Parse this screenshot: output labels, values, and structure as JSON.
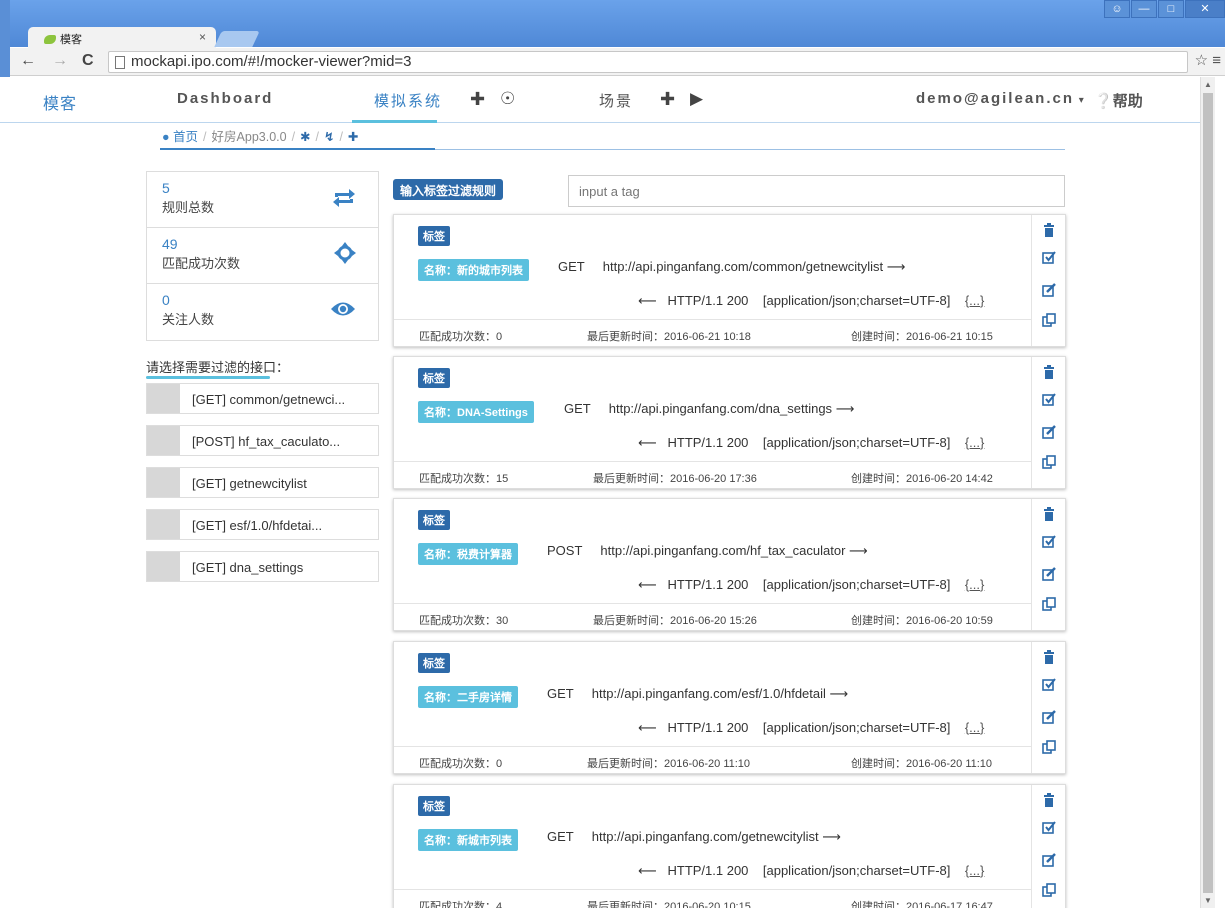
{
  "browser": {
    "tab_title": "模客",
    "tab_close": "×",
    "url": "mockapi.ipo.com/#!/mocker-viewer?mid=3",
    "back": "←",
    "forward": "→",
    "reload": "C",
    "toolbar_right": "☆ ≡"
  },
  "nav": {
    "brand": "模客",
    "dashboard": "Dashboard",
    "mock_system": "模拟系统",
    "scenes": "场景",
    "user": "demo@agilean.cn",
    "help": "帮助"
  },
  "breadcrumb": {
    "home": "首页",
    "project": "好房App3.0.0"
  },
  "stats": [
    {
      "value": "5",
      "label": "规则总数",
      "icon": "refresh-icon"
    },
    {
      "value": "49",
      "label": "匹配成功次数",
      "icon": "crosshair-icon"
    },
    {
      "value": "0",
      "label": "关注人数",
      "icon": "eye-icon"
    }
  ],
  "filter": {
    "title": "请选择需要过滤的接口：",
    "items": [
      "[GET] common/getnewci...",
      "[POST] hf_tax_caculato...",
      "[GET] getnewcitylist",
      "[GET] esf/1.0/hfdetai...",
      "[GET] dna_settings"
    ]
  },
  "tag_filter": {
    "label": "输入标签过滤规则",
    "placeholder": "input a tag"
  },
  "cards": [
    {
      "tag": "标签",
      "name": "名称：新的城市列表",
      "method": "GET",
      "url": "http://api.pinganfang.com/common/getnewcitylist",
      "arrow_out": "⟶",
      "arrow_in": "⟵",
      "status": "HTTP/1.1 200",
      "ctype": "[application/json;charset=UTF-8]",
      "body": "{...}",
      "match": "匹配成功次数：0",
      "updated": "最后更新时间：2016-06-21 10:18",
      "created": "创建时间：2016-06-21 10:15"
    },
    {
      "tag": "标签",
      "name": "名称：DNA-Settings",
      "method": "GET",
      "url": "http://api.pinganfang.com/dna_settings",
      "arrow_out": "⟶",
      "arrow_in": "⟵",
      "status": "HTTP/1.1 200",
      "ctype": "[application/json;charset=UTF-8]",
      "body": "{...}",
      "match": "匹配成功次数：15",
      "updated": "最后更新时间：2016-06-20 17:36",
      "created": "创建时间：2016-06-20 14:42"
    },
    {
      "tag": "标签",
      "name": "名称：税费计算器",
      "method": "POST",
      "url": "http://api.pinganfang.com/hf_tax_caculator",
      "arrow_out": "⟶",
      "arrow_in": "⟵",
      "status": "HTTP/1.1 200",
      "ctype": "[application/json;charset=UTF-8]",
      "body": "{...}",
      "match": "匹配成功次数：30",
      "updated": "最后更新时间：2016-06-20 15:26",
      "created": "创建时间：2016-06-20 10:59"
    },
    {
      "tag": "标签",
      "name": "名称：二手房详情",
      "method": "GET",
      "url": "http://api.pinganfang.com/esf/1.0/hfdetail",
      "arrow_out": "⟶",
      "arrow_in": "⟵",
      "status": "HTTP/1.1 200",
      "ctype": "[application/json;charset=UTF-8]",
      "body": "{...}",
      "match": "匹配成功次数：0",
      "updated": "最后更新时间：2016-06-20 11:10",
      "created": "创建时间：2016-06-20 11:10"
    },
    {
      "tag": "标签",
      "name": "名称：新城市列表",
      "method": "GET",
      "url": "http://api.pinganfang.com/getnewcitylist",
      "arrow_out": "⟶",
      "arrow_in": "⟵",
      "status": "HTTP/1.1 200",
      "ctype": "[application/json;charset=UTF-8]",
      "body": "{...}",
      "match": "匹配成功次数：4",
      "updated": "最后更新时间：2016-06-20 10:15",
      "created": "创建时间：2016-06-17 16:47"
    }
  ],
  "colors": {
    "primary": "#3a82c4",
    "tag_dark": "#2d6aa9",
    "tag_light": "#5bc0de"
  }
}
